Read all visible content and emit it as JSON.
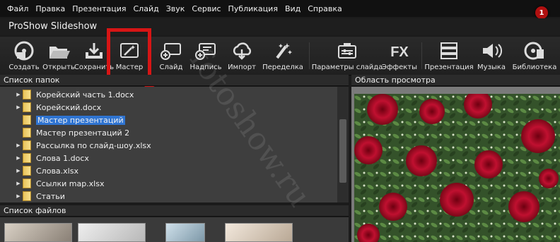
{
  "menu": [
    "Файл",
    "Правка",
    "Презентация",
    "Слайд",
    "Звук",
    "Сервис",
    "Публикация",
    "Вид",
    "Справка"
  ],
  "notification_count": "1",
  "app_title": "ProShow Slideshow",
  "toolbar": {
    "create": "Создать",
    "open": "Открыть",
    "save": "Сохранить",
    "wizard": "Мастер",
    "slide": "Слайд",
    "caption": "Надпись",
    "import": "Импорт",
    "remake": "Переделка",
    "slide_options": "Параметры слайда",
    "effects": "Эффекты",
    "presentation": "Презентация",
    "music": "Музыка",
    "library": "Библиотека"
  },
  "folders_header": "Список папок",
  "folders": [
    {
      "label": "Корейский часть 1.docx",
      "expandable": true,
      "selected": false
    },
    {
      "label": "Корейский.docx",
      "expandable": true,
      "selected": false
    },
    {
      "label": "Мастер презентаций",
      "expandable": false,
      "selected": true
    },
    {
      "label": "Мастер презентаций 2",
      "expandable": false,
      "selected": false
    },
    {
      "label": "Рассылка по слайд-шоу.xlsx",
      "expandable": true,
      "selected": false
    },
    {
      "label": "Слова 1.docx",
      "expandable": true,
      "selected": false
    },
    {
      "label": "Слова.xlsx",
      "expandable": true,
      "selected": false
    },
    {
      "label": "Ссылки map.xlsx",
      "expandable": true,
      "selected": false
    },
    {
      "label": "Статьи",
      "expandable": true,
      "selected": false
    }
  ],
  "files_header": "Список файлов",
  "preview_header": "Область просмотра",
  "watermark": "fotoshow.ru",
  "colors": {
    "highlight": "#d71515",
    "selection": "#2f74d1",
    "folder": "#f0cf6a"
  }
}
